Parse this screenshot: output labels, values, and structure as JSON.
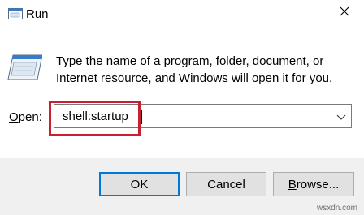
{
  "window": {
    "title": "Run",
    "app_icon": "run-icon",
    "close_icon": "close-icon"
  },
  "body": {
    "icon": "program-window-icon",
    "description": "Type the name of a program, folder, document, or Internet resource, and Windows will open it for you."
  },
  "open_field": {
    "label_mnemonic": "O",
    "label_rest": "pen:",
    "value": "shell:startup",
    "dropdown_icon": "chevron-down-icon"
  },
  "buttons": {
    "ok": "OK",
    "cancel": "Cancel",
    "browse_mnemonic": "B",
    "browse_rest": "rowse..."
  },
  "watermark": "wsxdn.com",
  "colors": {
    "highlight": "#c8202e",
    "focus": "#0078d7",
    "footer_bg": "#f0f0f0"
  }
}
